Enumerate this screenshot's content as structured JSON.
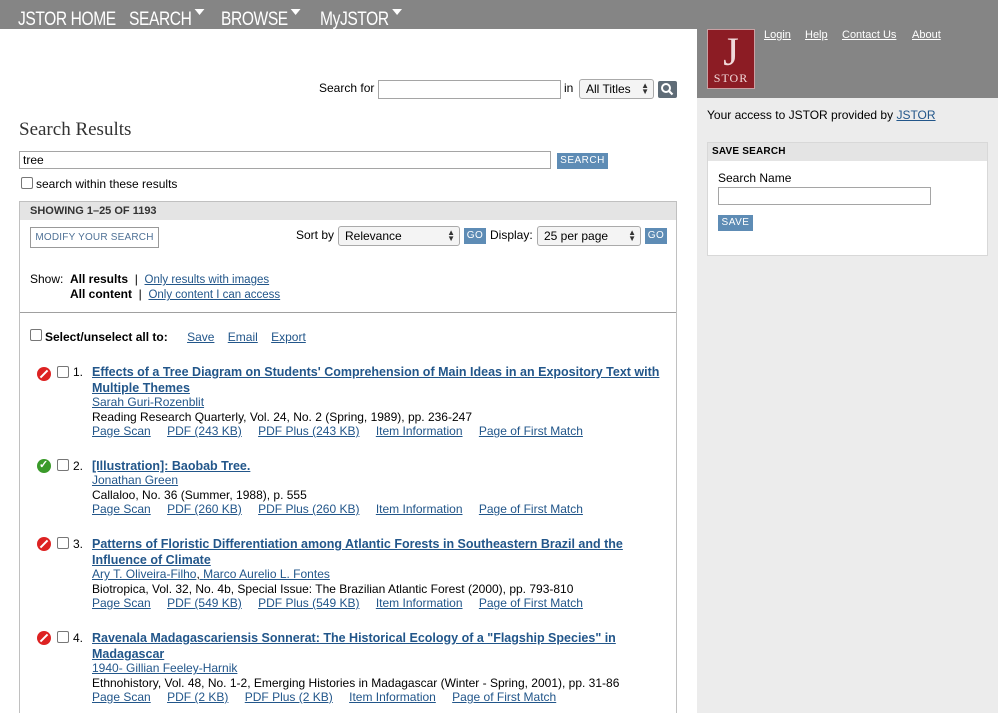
{
  "nav": {
    "home": "JSTOR HOME",
    "search": "SEARCH",
    "browse": "BROWSE",
    "myjstor": "MyJSTOR"
  },
  "top_links": {
    "login": "Login",
    "help": "Help",
    "contact": "Contact Us",
    "about": "About"
  },
  "logo": {
    "letter": "J",
    "text": "STOR"
  },
  "access": {
    "prefix": "Your access to JSTOR provided by ",
    "provider": "JSTOR"
  },
  "save_search": {
    "header": "SAVE SEARCH",
    "name_label": "Search Name",
    "button": "SAVE"
  },
  "search_bar": {
    "label": "Search for",
    "in_label": "in",
    "scope": "All Titles"
  },
  "page_title": "Search Results",
  "query": {
    "value": "tree",
    "button": "SEARCH",
    "within_label": "search within these results"
  },
  "results_header": {
    "showing": "SHOWING 1–25 OF 1193",
    "modify": "MODIFY YOUR SEARCH",
    "sort_label": "Sort by",
    "sort_value": "Relevance",
    "go": "GO",
    "display_label": "Display:",
    "display_value": "25 per page"
  },
  "filters": {
    "show_label": "Show:",
    "all_results": "All results",
    "images_only": "Only results with images",
    "all_content": "All content",
    "access_only": "Only content I can access",
    "divider": "|"
  },
  "select_all": {
    "label": "Select/unselect all to:",
    "save": "Save",
    "email": "Email",
    "export": "Export"
  },
  "results": [
    {
      "num": "1.",
      "access": "denied",
      "title": "Effects of a Tree Diagram on Students' Comprehension of Main Ideas in an Expository Text with Multiple Themes",
      "authors": [
        "Sarah Guri-Rozenblit"
      ],
      "source": "Reading Research Quarterly, Vol. 24, No. 2 (Spring, 1989), pp. 236-247",
      "links": [
        "Page Scan",
        "PDF (243 KB)",
        "PDF Plus (243 KB)",
        "Item Information",
        "Page of First Match"
      ]
    },
    {
      "num": "2.",
      "access": "ok",
      "title": "[Illustration]: Baobab Tree.",
      "authors": [
        "Jonathan Green"
      ],
      "source": "Callaloo, No. 36 (Summer, 1988), p. 555",
      "links": [
        "Page Scan",
        "PDF (260 KB)",
        "PDF Plus (260 KB)",
        "Item Information",
        "Page of First Match"
      ]
    },
    {
      "num": "3.",
      "access": "denied",
      "title": "Patterns of Floristic Differentiation among Atlantic Forests in Southeastern Brazil and the Influence of Climate",
      "authors": [
        "Ary T. Oliveira-Filho",
        "Marco Aurelio L. Fontes"
      ],
      "source": "Biotropica, Vol. 32, No. 4b, Special Issue: The Brazilian Atlantic Forest (2000), pp. 793-810",
      "links": [
        "Page Scan",
        "PDF (549 KB)",
        "PDF Plus (549 KB)",
        "Item Information",
        "Page of First Match"
      ]
    },
    {
      "num": "4.",
      "access": "denied",
      "title": "Ravenala Madagascariensis Sonnerat: The Historical Ecology of a \"Flagship Species\" in Madagascar",
      "authors": [
        "1940- Gillian Feeley-Harnik"
      ],
      "source": "Ethnohistory, Vol. 48, No. 1-2, Emerging Histories in Madagascar (Winter - Spring, 2001), pp. 31-86",
      "links": [
        "Page Scan",
        "PDF (2 KB)",
        "PDF Plus (2 KB)",
        "Item Information",
        "Page of First Match"
      ]
    }
  ]
}
